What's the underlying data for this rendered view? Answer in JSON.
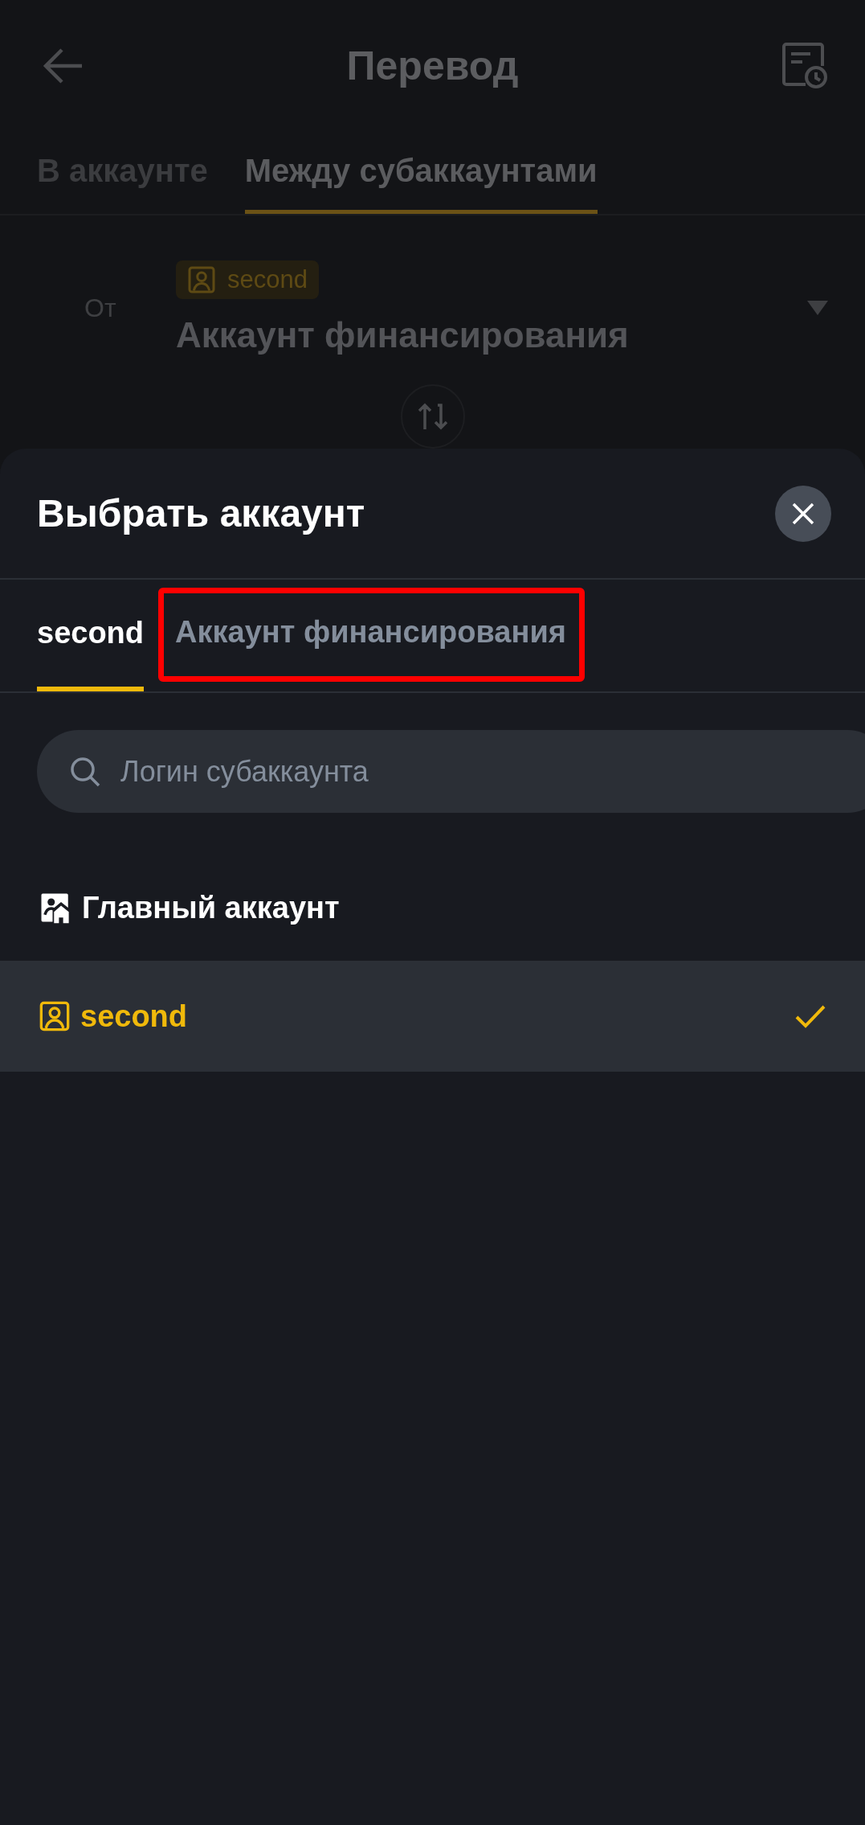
{
  "header": {
    "title": "Перевод"
  },
  "tabs": [
    {
      "label": "В аккаунте",
      "selected": false
    },
    {
      "label": "Между субаккаунтами",
      "selected": true
    }
  ],
  "from": {
    "label": "От",
    "badge": "second",
    "account": "Аккаунт финансирования"
  },
  "sheet": {
    "title": "Выбрать аккаунт",
    "tabs": [
      {
        "label": "second",
        "selected": true,
        "highlighted": false
      },
      {
        "label": "Аккаунт финансирования",
        "selected": false,
        "highlighted": true
      }
    ],
    "search": {
      "placeholder": "Логин субаккаунта"
    },
    "accounts": [
      {
        "kind": "main",
        "name": "Главный аккаунт",
        "selected": false
      },
      {
        "kind": "sub",
        "name": "second",
        "selected": true
      }
    ]
  }
}
